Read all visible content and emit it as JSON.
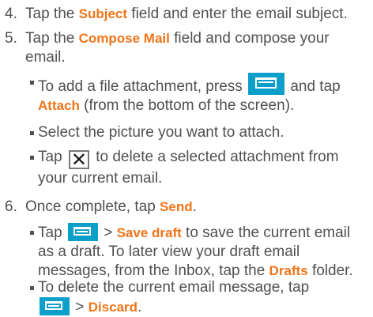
{
  "steps": [
    {
      "num": "4.",
      "pre": "Tap the ",
      "hl": "Subject",
      "post": " field and enter the email subject."
    },
    {
      "num": "5.",
      "pre": "Tap the ",
      "hl": "Compose Mail",
      "post": " field and compose your email."
    },
    {
      "num": "6.",
      "pre": "Once complete, tap ",
      "hl": "Send",
      "post": "."
    }
  ],
  "bullets5": {
    "b1": {
      "pre": "To add a file attachment, press",
      "mid": " and tap ",
      "hl": "Attach",
      "post": " (from the bottom of the screen)."
    },
    "b2": {
      "text": "Select the picture you want to attach."
    },
    "b3": {
      "pre": "Tap",
      "post": " to delete a selected attachment from your current email."
    }
  },
  "bullets6": {
    "b1": {
      "pre": "Tap ",
      "gt": " > ",
      "hl": "Save draft",
      "mid": " to save the current email as a draft. To later view your draft email messages, from the Inbox, tap the ",
      "hl2": "Drafts",
      "post": " folder."
    },
    "b2": {
      "pre": "To delete the current email message, tap",
      "gt": " > ",
      "hl": "Discard",
      "post": "."
    }
  },
  "icons": {
    "menu_key": "menu-key-icon",
    "delete": "close-x-icon"
  },
  "colors": {
    "accent": "#f07418",
    "icon_blue": "#0c9fc9",
    "text": "#505050"
  }
}
